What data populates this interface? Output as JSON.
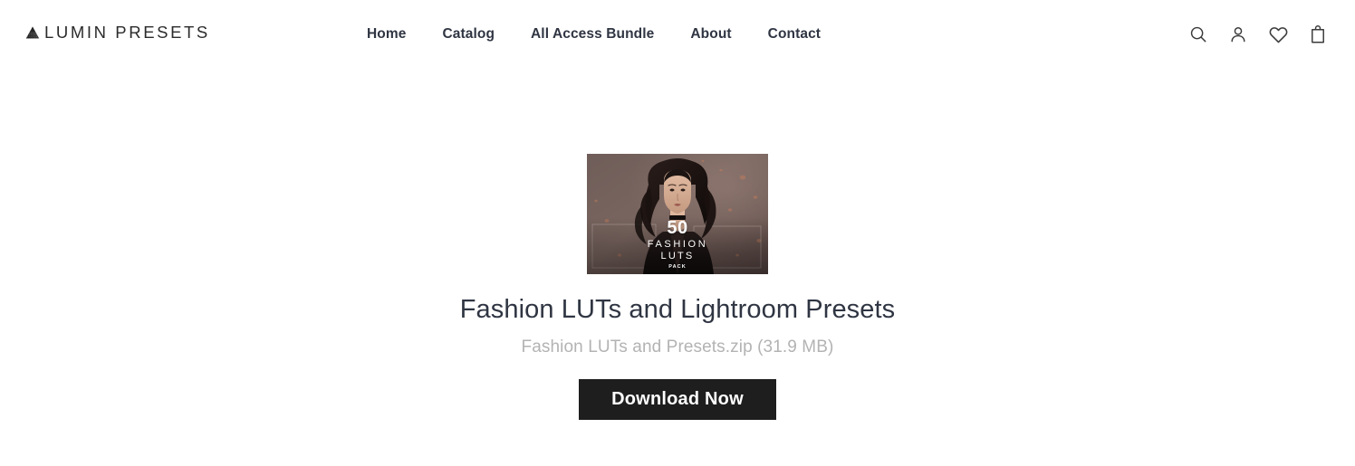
{
  "header": {
    "brand": {
      "name": "LUMIN PRESETS",
      "logo_icon": "mountain-triangle-icon"
    },
    "nav": [
      {
        "label": "Home",
        "name": "home"
      },
      {
        "label": "Catalog",
        "name": "catalog"
      },
      {
        "label": "All Access Bundle",
        "name": "all-access-bundle"
      },
      {
        "label": "About",
        "name": "about"
      },
      {
        "label": "Contact",
        "name": "contact"
      }
    ],
    "actions": [
      {
        "icon": "search-icon",
        "label": "Search"
      },
      {
        "icon": "account-person-icon",
        "label": "Account"
      },
      {
        "icon": "heart-wishlist-icon",
        "label": "Wishlist"
      },
      {
        "icon": "shopping-bag-icon",
        "label": "Cart"
      }
    ]
  },
  "main": {
    "thumbnail": {
      "count": "50",
      "line1": "FASHION",
      "line2": "LUTS",
      "tag": "PACK",
      "alt": "Fashion model in black jacket with 50 Fashion LUTs Pack overlay"
    },
    "product_title": "Fashion LUTs and Lightroom Presets",
    "file_name_and_size": "Fashion LUTs and Presets.zip (31.9 MB)",
    "download_label": "Download Now"
  },
  "colors": {
    "page_background": "#ffffff",
    "title_text": "#2f3542",
    "meta_text": "#b3b3b3",
    "nav_text": "#2f3542",
    "brand_text": "#2b2b2b",
    "button_background": "#1e1e1e",
    "button_text": "#ffffff",
    "icon_stroke": "#3a3a3a"
  }
}
